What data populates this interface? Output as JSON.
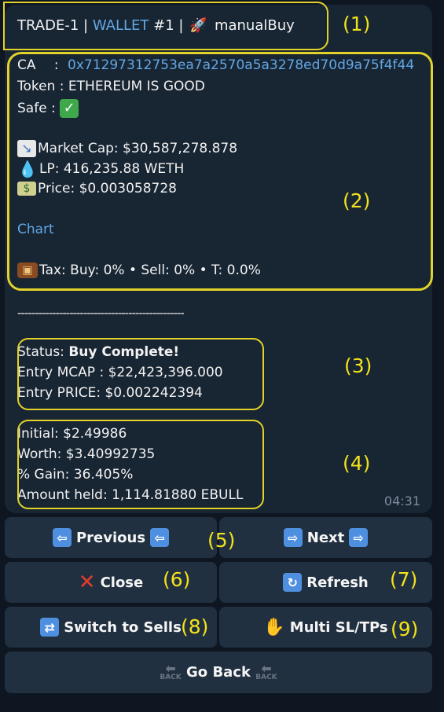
{
  "header": {
    "trade": "TRADE-1",
    "sep1": "|",
    "wallet": "WALLET",
    "wallet_num": "#1",
    "sep2": "|",
    "mode": "manualBuy"
  },
  "token": {
    "ca_label": "CA",
    "ca_colon": ":",
    "ca_value": "0x71297312753ea7a2570a5a3278ed70d9a75f4f44",
    "token_label": "Token :",
    "token_value": "ETHEREUM IS GOOD",
    "safe_label": "Safe :",
    "market_cap": "Market Cap: $30,587,278.878",
    "lp": "LP: 416,235.88 WETH",
    "price": "Price: $0.003058728",
    "chart_link": "Chart",
    "tax": "Tax: Buy: 0% • Sell: 0% • T: 0.0%"
  },
  "divider": "------------------------------------------------",
  "status": {
    "label": "Status: ",
    "value": "Buy Complete!",
    "entry_mcap": "Entry MCAP : $22,423,396.000",
    "entry_price": "Entry PRICE: $0.002242394"
  },
  "position": {
    "initial": "Initial: $2.49986",
    "worth": "Worth: $3.40992735",
    "gain": "% Gain: 36.405%",
    "amount": "Amount held: 1,114.81880 EBULL"
  },
  "timestamp": "04:31",
  "buttons": {
    "previous": "Previous",
    "next": "Next",
    "close": "Close",
    "refresh": "Refresh",
    "switch_sells": "Switch to Sells",
    "multi_sltp": "Multi SL/TPs",
    "go_back": "Go Back"
  },
  "annotations": [
    "(1)",
    "(2)",
    "(3)",
    "(4)",
    "(5)",
    "(6)",
    "(7)",
    "(8)",
    "(9)"
  ],
  "icons": {
    "rocket": "rocket-icon",
    "check": "check-mark-icon",
    "chart": "chart-decreasing-icon",
    "droplet": "droplet-icon",
    "money": "money-icon",
    "briefcase": "briefcase-icon",
    "left_arrow": "left-arrow-icon",
    "right_arrow": "right-arrow-icon",
    "cross": "cross-mark-icon",
    "refresh": "refresh-icon",
    "shuffle": "shuffle-icon",
    "hand": "raised-hand-icon",
    "back": "back-arrow-icon"
  },
  "colors": {
    "background": "#0e1621",
    "bubble": "#182533",
    "button": "#213040",
    "link": "#62a8e6",
    "highlight": "#e2d22a"
  }
}
